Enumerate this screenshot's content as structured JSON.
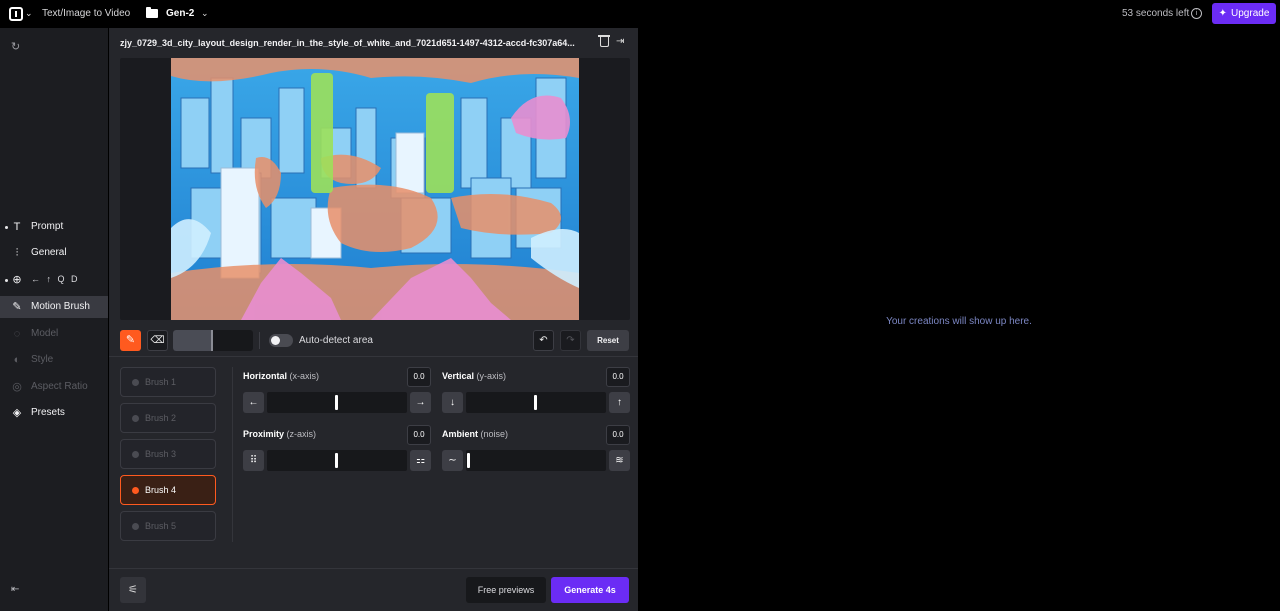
{
  "topbar": {
    "mode": "Text/Image to Video",
    "project": "Gen-2",
    "time_left": "53 seconds left",
    "upgrade": "Upgrade"
  },
  "sidebar": {
    "items": [
      {
        "label": "Prompt",
        "icon": "text-T-icon"
      },
      {
        "label": "General",
        "icon": "sliders-icon"
      },
      {
        "label": "",
        "icon": "camera-motion-icon",
        "mini": "← ↑ Q D"
      },
      {
        "label": "Motion Brush",
        "icon": "brush-icon"
      },
      {
        "label": "Model",
        "icon": "model-icon"
      },
      {
        "label": "Style",
        "icon": "palette-icon"
      },
      {
        "label": "Aspect Ratio",
        "icon": "aspect-ratio-icon"
      },
      {
        "label": "Presets",
        "icon": "layers-icon"
      }
    ]
  },
  "editor": {
    "file_title": "zjy_0729_3d_city_layout_design_render_in_the_style_of_white_and_7021d651-1497-4312-accd-fc307a64...",
    "auto_detect": "Auto-detect area",
    "reset": "Reset",
    "brush_size": 0.5,
    "brushes": [
      "Brush 1",
      "Brush 2",
      "Brush 3",
      "Brush 4",
      "Brush 5"
    ],
    "active_brush": "Brush 4",
    "params": {
      "horizontal": {
        "label": "Horizontal",
        "sub": "(x-axis)",
        "value": "0.0"
      },
      "vertical": {
        "label": "Vertical",
        "sub": "(y-axis)",
        "value": "0.0"
      },
      "proximity": {
        "label": "Proximity",
        "sub": "(z-axis)",
        "value": "0.0"
      },
      "ambient": {
        "label": "Ambient",
        "sub": "(noise)",
        "value": "0.0"
      }
    },
    "free_previews": "Free previews",
    "generate": "Generate 4s"
  },
  "right_panel": {
    "empty_message": "Your creations will show up here."
  },
  "colors": {
    "accent_purple": "#6b2cf5",
    "brush_orange": "#ff5a1f"
  }
}
